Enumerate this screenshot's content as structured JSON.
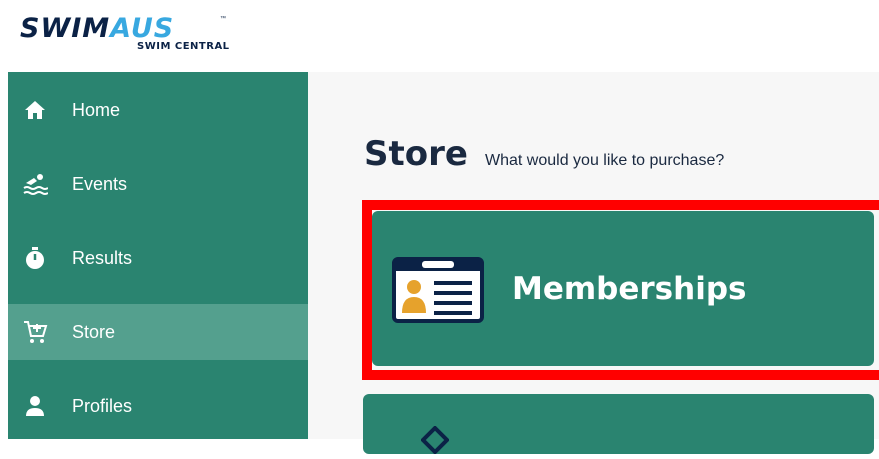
{
  "brand": {
    "logo_swim": "SWIM",
    "logo_aus": "AUS",
    "logo_tm": "™",
    "logo_sub": "SWIM CENTRAL"
  },
  "sidebar": {
    "items": [
      {
        "label": "Home",
        "icon": "home-icon"
      },
      {
        "label": "Events",
        "icon": "swimmer-icon"
      },
      {
        "label": "Results",
        "icon": "stopwatch-icon"
      },
      {
        "label": "Store",
        "icon": "cart-icon",
        "active": true
      },
      {
        "label": "Profiles",
        "icon": "person-icon"
      }
    ]
  },
  "main": {
    "title": "Store",
    "subtitle": "What would you like to purchase?",
    "cards": [
      {
        "label": "Memberships",
        "icon": "id-card-icon"
      },
      {
        "label": "",
        "icon": "diamond-icon"
      }
    ]
  },
  "colors": {
    "sidebar_bg": "#2a8470",
    "sidebar_active": "#54a08e",
    "card_bg": "#2a8470",
    "title_color": "#1a2940",
    "highlight": "#ff0000",
    "logo_navy": "#0b2246",
    "logo_blue": "#38a8e0"
  }
}
